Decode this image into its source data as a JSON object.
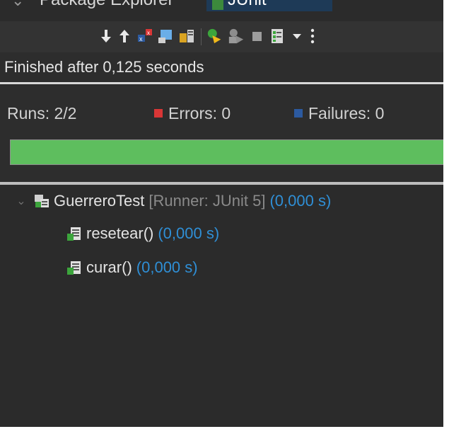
{
  "tabs": [
    {
      "label": "Package Explorer"
    },
    {
      "label": "JUnit",
      "icon": "junit-tab-icon"
    }
  ],
  "toolbar": {
    "items": [
      {
        "name": "next-failure-icon"
      },
      {
        "name": "previous-failure-icon"
      },
      {
        "name": "show-failures-only-icon"
      },
      {
        "name": "show-skipped-only-icon"
      },
      {
        "name": "scroll-lock-icon"
      },
      {
        "name": "rerun-test-icon"
      },
      {
        "name": "rerun-failures-first-icon"
      },
      {
        "name": "stop-icon"
      },
      {
        "name": "test-run-history-icon"
      },
      {
        "name": "dropdown-icon"
      },
      {
        "name": "view-menu-icon"
      }
    ]
  },
  "status": {
    "text": "Finished after 0,125 seconds"
  },
  "counters": {
    "runs": "Runs:  2/2",
    "errors": "Errors:  0",
    "failures": "Failures:  0"
  },
  "progress": {
    "fraction": 1.0,
    "color": "#5ebe5e"
  },
  "tree": {
    "root": {
      "name": "GuerreroTest",
      "runner": "[Runner: JUnit 5]",
      "time": "(0,000 s)"
    },
    "children": [
      {
        "name": "resetear()",
        "time": "(0,000 s)"
      },
      {
        "name": "curar()",
        "time": "(0,000 s)"
      }
    ]
  },
  "colors": {
    "background": "#2b2b2b",
    "time_text": "#2f8fd6",
    "runner_text": "#8a8a8a",
    "success": "#5ebe5e"
  }
}
